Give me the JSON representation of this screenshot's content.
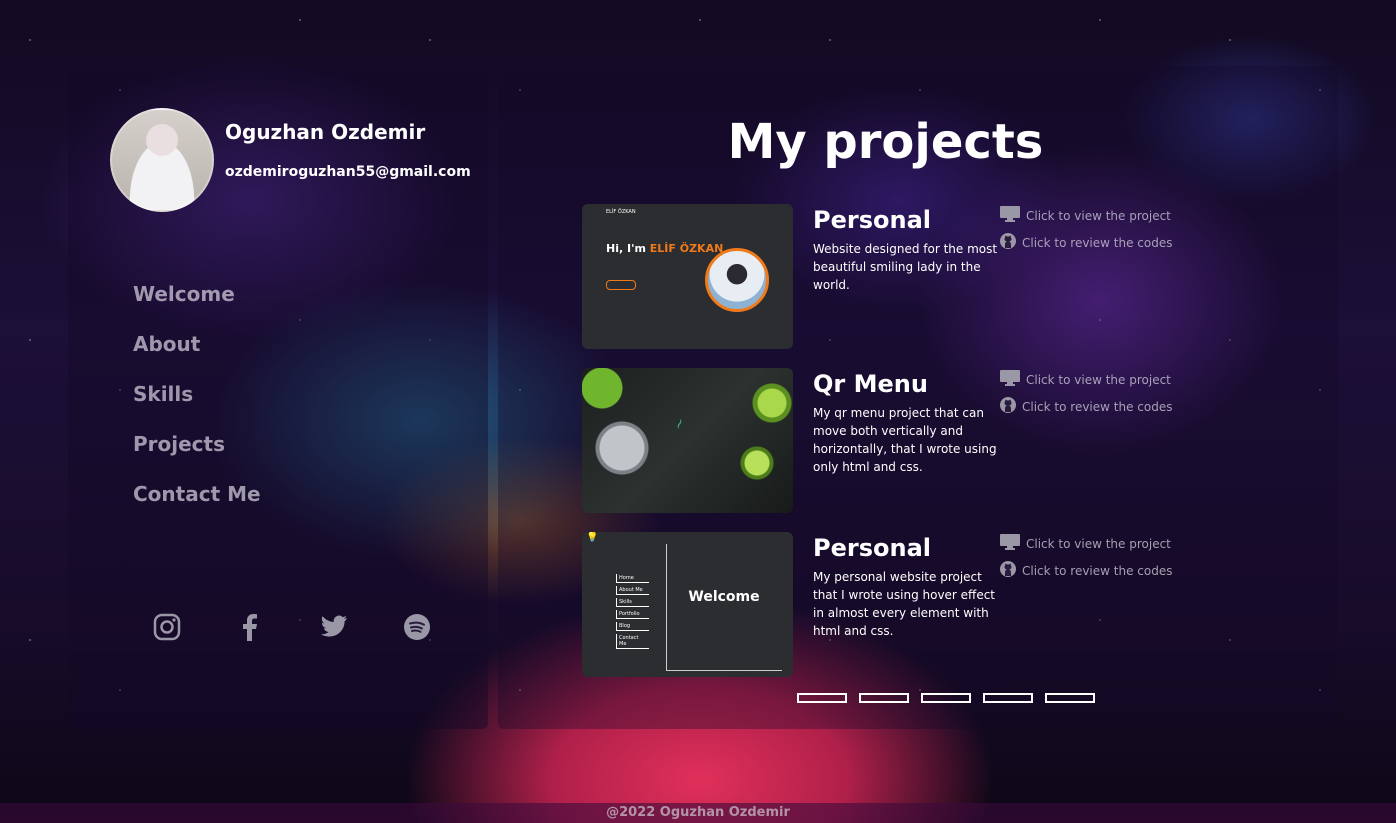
{
  "profile": {
    "name": "Oguzhan Ozdemir",
    "email": "ozdemiroguzhan55@gmail.com"
  },
  "nav": {
    "items": [
      {
        "label": "Welcome"
      },
      {
        "label": "About"
      },
      {
        "label": "Skills"
      },
      {
        "label": "Projects"
      },
      {
        "label": "Contact Me"
      }
    ]
  },
  "social": [
    "instagram-icon",
    "facebook-icon",
    "twitter-icon",
    "spotify-icon"
  ],
  "main": {
    "title": "My projects",
    "view_label": "Click to view the project",
    "code_label": "Click to review the codes",
    "projects": [
      {
        "title": "Personal",
        "description": "Website designed for the most beautiful smiling lady in the world.",
        "thumb": {
          "nav": "ELİF ÖZKAN",
          "greeting": "Hi, I'm",
          "name": "ELİF ÖZKAN"
        }
      },
      {
        "title": "Qr Menu",
        "description": "My qr menu project that can move both vertically and horizontally, that I wrote using only html and css.",
        "thumb": {}
      },
      {
        "title": "Personal",
        "description": "My personal website project that I wrote using hover effect in almost every element with html and css.",
        "thumb": {
          "menu": [
            "Home",
            "About Me",
            "Skills",
            "Portfolio",
            "Blog",
            "Contact Me"
          ],
          "heading": "Welcome"
        }
      }
    ],
    "indicator_count": 5
  },
  "footer": {
    "text": "@2022 Oguzhan Ozdemir"
  },
  "colors": {
    "accent": "#f07a1a",
    "text": "#ffffff"
  }
}
